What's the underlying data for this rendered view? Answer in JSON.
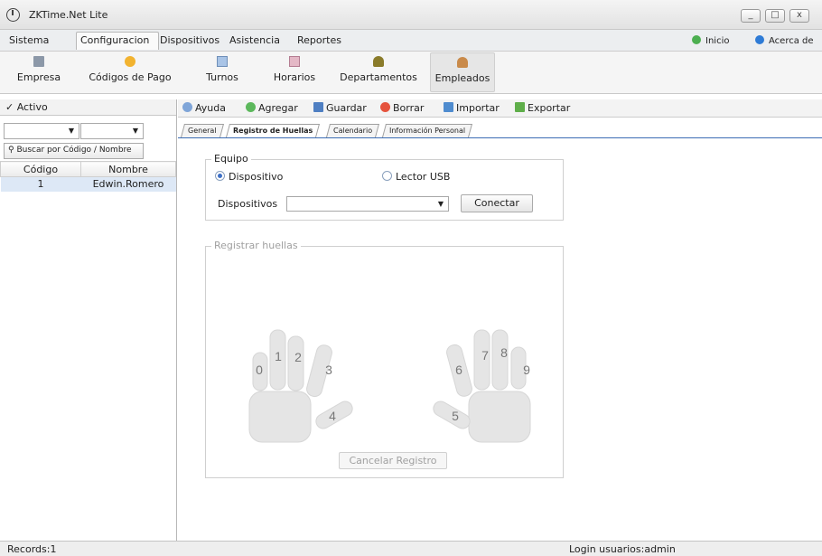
{
  "window": {
    "title": "ZKTime.Net Lite",
    "controls": {
      "minimize": "_",
      "maximize": "□",
      "close": "x"
    }
  },
  "menu": {
    "items": [
      "Sistema",
      "Configuracion",
      "Dispositivos",
      "Asistencia",
      "Reportes"
    ],
    "right": {
      "inicio": "Inicio",
      "acerca": "Acerca de"
    }
  },
  "toolbar": {
    "items": [
      "Empresa",
      "Códigos de Pago",
      "Turnos",
      "Horarios",
      "Departamentos",
      "Empleados"
    ],
    "active": "Empleados"
  },
  "left": {
    "activo_label": "Activo",
    "search_label": "Buscar por Código / Nombre",
    "table": {
      "headers": [
        "Código",
        "Nombre"
      ],
      "rows": [
        {
          "codigo": "1",
          "nombre": "Edwin.Romero"
        }
      ]
    }
  },
  "actions": {
    "ayuda": "Ayuda",
    "agregar": "Agregar",
    "guardar": "Guardar",
    "borrar": "Borrar",
    "importar": "Importar",
    "exportar": "Exportar"
  },
  "tabs": {
    "general": "General",
    "huellas": "Registro de Huellas",
    "calendario": "Calendario",
    "personal": "Información Personal",
    "active": "Registro de Huellas"
  },
  "equipo": {
    "legend": "Equipo",
    "radio_dispositivo": "Dispositivo",
    "radio_usb": "Lector USB",
    "selected": "Dispositivo",
    "dispositivos_label": "Dispositivos",
    "dispositivos_value": "",
    "conectar_label": "Conectar"
  },
  "huellas": {
    "legend": "Registrar huellas",
    "fingers": [
      "0",
      "1",
      "2",
      "3",
      "4",
      "5",
      "6",
      "7",
      "8",
      "9"
    ],
    "cancelar_label": "Cancelar Registro"
  },
  "status": {
    "records": "Records:1",
    "login": "Login usuarios:admin"
  },
  "colors": {
    "accent": "#3c6db4",
    "selected_row": "#dde8f6",
    "hand": "#e5e5e5"
  }
}
